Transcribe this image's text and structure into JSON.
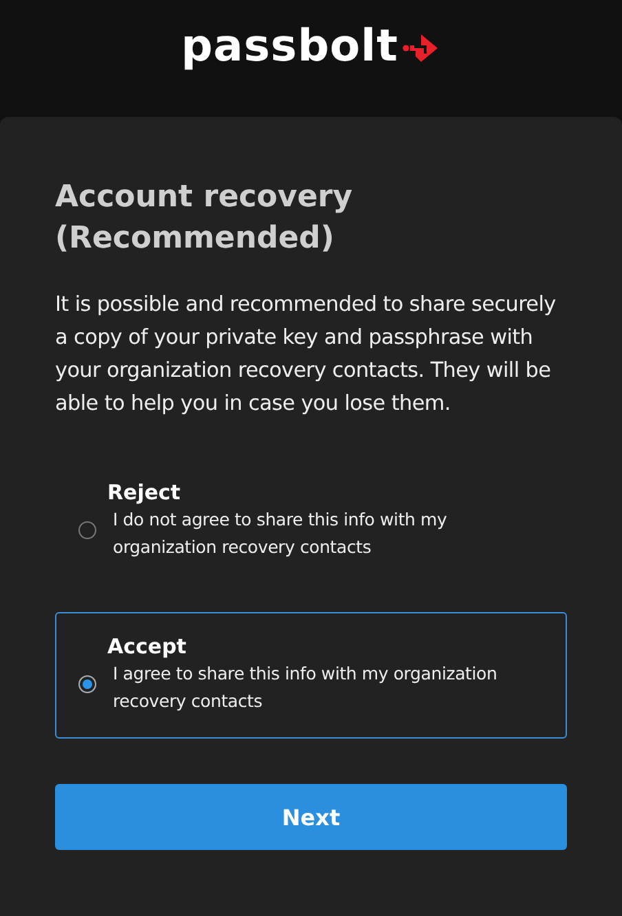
{
  "header": {
    "logo": "passbolt"
  },
  "title": "Account recovery (Recommended)",
  "description": "It is possible and recommended to share securely a copy of your private key and passphrase with your organization recovery contacts. They will be able to help you in case you lose them.",
  "options": [
    {
      "label": "Reject",
      "description": "I do not agree to share this info with my organization recovery contacts",
      "selected": false
    },
    {
      "label": "Accept",
      "description": "I agree to share this info with my organization recovery contacts",
      "selected": true
    }
  ],
  "button": "Next"
}
